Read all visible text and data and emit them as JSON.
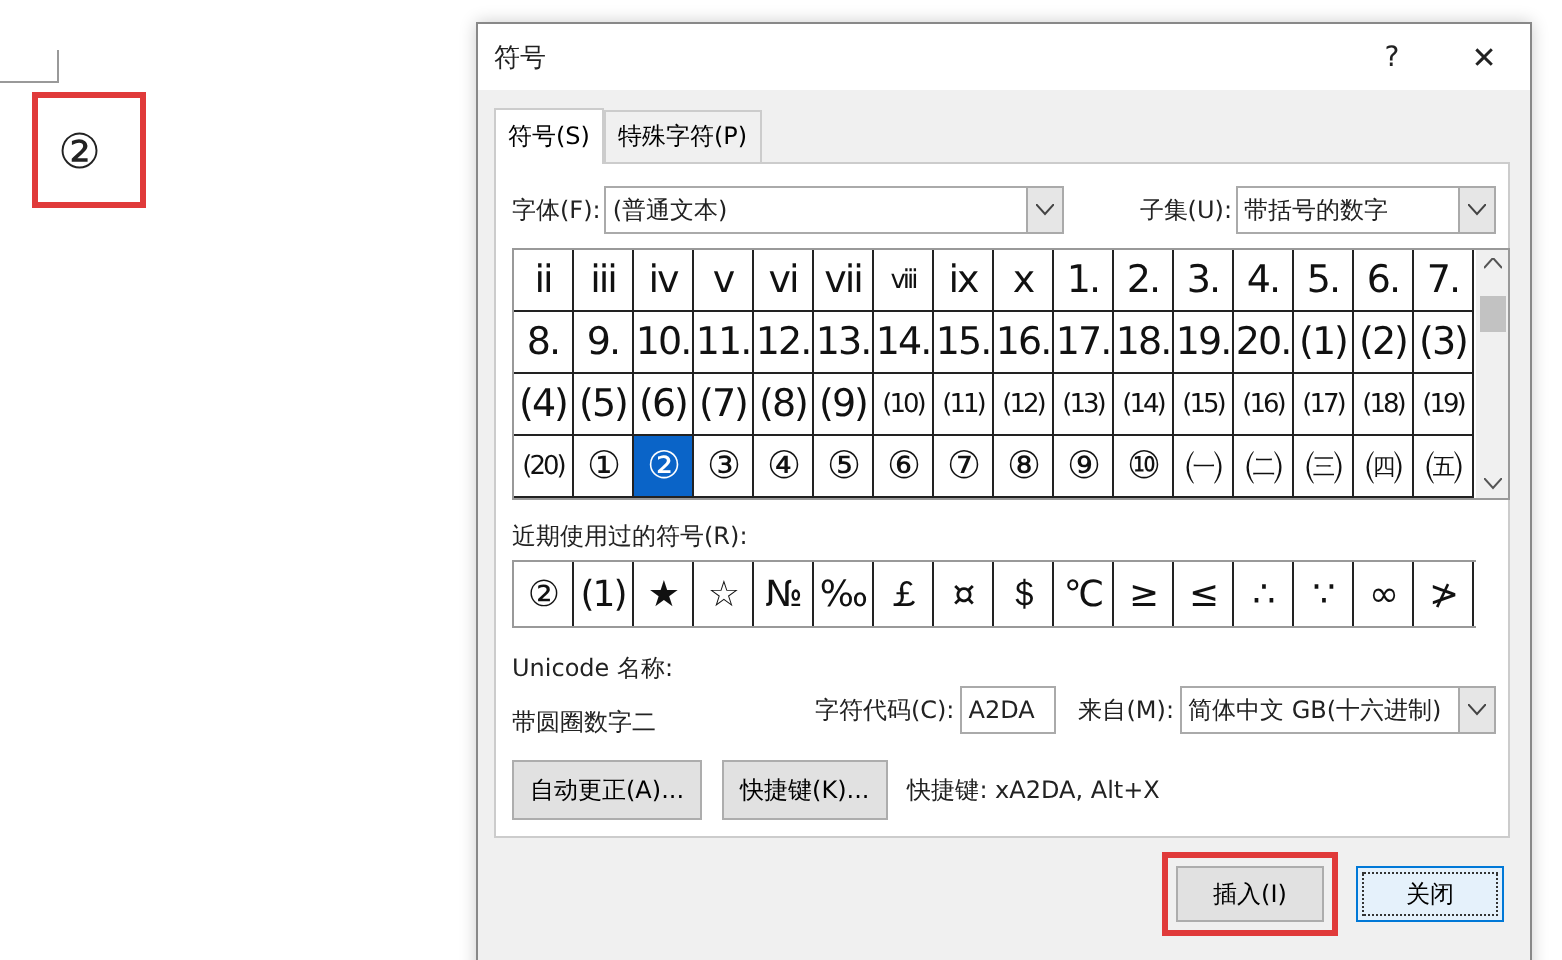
{
  "document": {
    "inserted_symbol": "②",
    "highlighted": true
  },
  "window": {
    "title": "符号",
    "help": "?",
    "close": "✕"
  },
  "tabs": [
    {
      "label": "符号(S)",
      "selected": true
    },
    {
      "label": "特殊字符(P)",
      "selected": false
    }
  ],
  "font": {
    "label": "字体(F):",
    "value": "(普通文本)"
  },
  "subset": {
    "label": "子集(U):",
    "value": "带括号的数字"
  },
  "symbols": [
    {
      "char": "ii",
      "selected": false
    },
    {
      "char": "iii",
      "selected": false
    },
    {
      "char": "iv",
      "selected": false
    },
    {
      "char": "v",
      "selected": false
    },
    {
      "char": "vi",
      "selected": false
    },
    {
      "char": "vii",
      "selected": false
    },
    {
      "char": "viii",
      "selected": false
    },
    {
      "char": "ix",
      "selected": false
    },
    {
      "char": "x",
      "selected": false
    },
    {
      "char": "1.",
      "selected": false
    },
    {
      "char": "2.",
      "selected": false
    },
    {
      "char": "3.",
      "selected": false
    },
    {
      "char": "4.",
      "selected": false
    },
    {
      "char": "5.",
      "selected": false
    },
    {
      "char": "6.",
      "selected": false
    },
    {
      "char": "7.",
      "selected": false
    },
    {
      "char": "8.",
      "selected": false
    },
    {
      "char": "9.",
      "selected": false
    },
    {
      "char": "10.",
      "selected": false
    },
    {
      "char": "11.",
      "selected": false
    },
    {
      "char": "12.",
      "selected": false
    },
    {
      "char": "13.",
      "selected": false
    },
    {
      "char": "14.",
      "selected": false
    },
    {
      "char": "15.",
      "selected": false
    },
    {
      "char": "16.",
      "selected": false
    },
    {
      "char": "17.",
      "selected": false
    },
    {
      "char": "18.",
      "selected": false
    },
    {
      "char": "19.",
      "selected": false
    },
    {
      "char": "20.",
      "selected": false
    },
    {
      "char": "(1)",
      "selected": false
    },
    {
      "char": "(2)",
      "selected": false
    },
    {
      "char": "(3)",
      "selected": false
    },
    {
      "char": "(4)",
      "selected": false
    },
    {
      "char": "(5)",
      "selected": false
    },
    {
      "char": "(6)",
      "selected": false
    },
    {
      "char": "(7)",
      "selected": false
    },
    {
      "char": "(8)",
      "selected": false
    },
    {
      "char": "(9)",
      "selected": false
    },
    {
      "char": "(10)",
      "selected": false
    },
    {
      "char": "(11)",
      "selected": false
    },
    {
      "char": "(12)",
      "selected": false
    },
    {
      "char": "(13)",
      "selected": false
    },
    {
      "char": "(14)",
      "selected": false
    },
    {
      "char": "(15)",
      "selected": false
    },
    {
      "char": "(16)",
      "selected": false
    },
    {
      "char": "(17)",
      "selected": false
    },
    {
      "char": "(18)",
      "selected": false
    },
    {
      "char": "(19)",
      "selected": false
    },
    {
      "char": "(20)",
      "selected": false
    },
    {
      "char": "①",
      "selected": false
    },
    {
      "char": "②",
      "selected": true
    },
    {
      "char": "③",
      "selected": false
    },
    {
      "char": "④",
      "selected": false
    },
    {
      "char": "⑤",
      "selected": false
    },
    {
      "char": "⑥",
      "selected": false
    },
    {
      "char": "⑦",
      "selected": false
    },
    {
      "char": "⑧",
      "selected": false
    },
    {
      "char": "⑨",
      "selected": false
    },
    {
      "char": "⑩",
      "selected": false
    },
    {
      "char": "㈠",
      "selected": false
    },
    {
      "char": "㈡",
      "selected": false
    },
    {
      "char": "㈢",
      "selected": false
    },
    {
      "char": "㈣",
      "selected": false
    },
    {
      "char": "㈤",
      "selected": false
    }
  ],
  "recent": {
    "label": "近期使用过的符号(R):",
    "symbols": [
      "②",
      "(1)",
      "★",
      "☆",
      "№",
      "‰",
      "￡",
      "¤",
      "＄",
      "℃",
      "≥",
      "≤",
      "∴",
      "∵",
      "∞",
      "≯"
    ]
  },
  "unicode_name": {
    "label": "Unicode 名称:",
    "value": "带圆圈数字二"
  },
  "char_code": {
    "label": "字符代码(C):",
    "value": "A2DA"
  },
  "from": {
    "label": "来自(M):",
    "value": "简体中文 GB(十六进制)"
  },
  "buttons": [
    {
      "label": "自动更正(A)..."
    },
    {
      "label": "快捷键(K)..."
    }
  ],
  "shortcut": "快捷键: xA2DA, Alt+X",
  "footer": [
    {
      "label": "插入(I)",
      "kind": "insert",
      "highlighted": true
    },
    {
      "label": "关闭",
      "kind": "close",
      "highlighted": false
    }
  ]
}
